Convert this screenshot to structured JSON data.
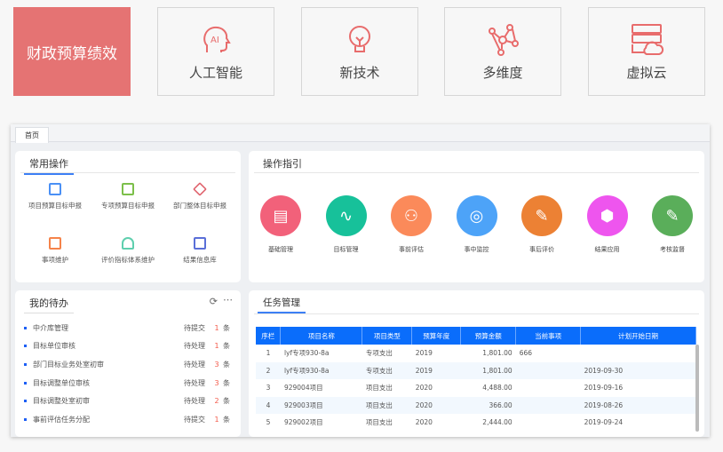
{
  "tiles": [
    {
      "label": "财政预算绩效",
      "icon": "brand"
    },
    {
      "label": "人工智能",
      "icon": "ai-head-icon"
    },
    {
      "label": "新技术",
      "icon": "lightbulb-icon"
    },
    {
      "label": "多维度",
      "icon": "network-icon"
    },
    {
      "label": "虚拟云",
      "icon": "cloud-server-icon"
    }
  ],
  "tab": "首页",
  "common": {
    "title": "常用操作",
    "items": [
      {
        "label": "项目预算目标申报",
        "color": "#4a90f5"
      },
      {
        "label": "专项预算目标申报",
        "color": "#7cbf4a"
      },
      {
        "label": "部门整体目标申报",
        "color": "#e0646e"
      },
      {
        "label": "事项维护",
        "color": "#f5834a"
      },
      {
        "label": "评价指标体系维护",
        "color": "#5fcfae"
      },
      {
        "label": "结果信息库",
        "color": "#5a6fd8"
      }
    ]
  },
  "guide": {
    "title": "操作指引",
    "items": [
      {
        "label": "基础管理",
        "color": "#f2617a",
        "glyph": "▤"
      },
      {
        "label": "目标管理",
        "color": "#17c19a",
        "glyph": "∿"
      },
      {
        "label": "事前评估",
        "color": "#fb8a5a",
        "glyph": "⚇"
      },
      {
        "label": "事中监控",
        "color": "#4da3f8",
        "glyph": "◎"
      },
      {
        "label": "事后评价",
        "color": "#ec8134",
        "glyph": "✎"
      },
      {
        "label": "结果应用",
        "color": "#ee55ee",
        "glyph": "⬢"
      },
      {
        "label": "考核监督",
        "color": "#5aae5a",
        "glyph": "✎"
      }
    ]
  },
  "todo": {
    "title": "我的待办",
    "unit": "条",
    "items": [
      {
        "name": "中介库管理",
        "status": "待提交",
        "count": "1"
      },
      {
        "name": "目标单位审核",
        "status": "待处理",
        "count": "1"
      },
      {
        "name": "部门目标业务处室初审",
        "status": "待处理",
        "count": "3"
      },
      {
        "name": "目标调整单位审核",
        "status": "待处理",
        "count": "3"
      },
      {
        "name": "目标调整处室初审",
        "status": "待处理",
        "count": "2"
      },
      {
        "name": "事前评估任务分配",
        "status": "待提交",
        "count": "1"
      }
    ]
  },
  "tasks": {
    "title": "任务管理",
    "columns": [
      "序栏",
      "项目名称",
      "项目类型",
      "预算年度",
      "预算金额",
      "当前事项",
      "计划开始日期"
    ],
    "rows": [
      [
        "1",
        "lyf专项930-8a",
        "专项支出",
        "2019",
        "1,801.00",
        "666",
        ""
      ],
      [
        "2",
        "lyf专项930-8a",
        "专项支出",
        "2019",
        "1,801.00",
        "",
        "2019-09-30"
      ],
      [
        "3",
        "929004项目",
        "项目支出",
        "2020",
        "4,488.00",
        "",
        "2019-09-16"
      ],
      [
        "4",
        "929003项目",
        "项目支出",
        "2020",
        "366.00",
        "",
        "2019-08-26"
      ],
      [
        "5",
        "929002项目",
        "项目支出",
        "2020",
        "2,444.00",
        "",
        "2019-09-24"
      ]
    ]
  }
}
